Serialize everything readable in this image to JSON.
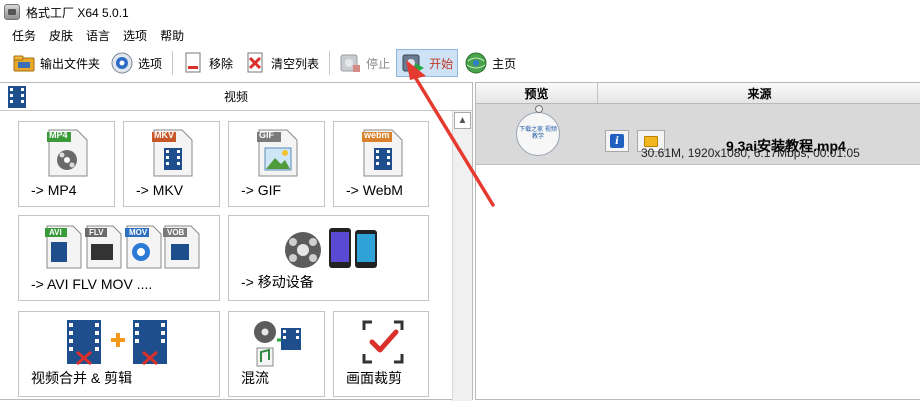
{
  "window": {
    "title": "格式工厂 X64 5.0.1"
  },
  "menu": {
    "items": [
      "任务",
      "皮肤",
      "语言",
      "选项",
      "帮助"
    ]
  },
  "toolbar": {
    "output_folder": "输出文件夹",
    "options": "选项",
    "remove": "移除",
    "clear_list": "清空列表",
    "stop": "停止",
    "start": "开始",
    "home": "主页"
  },
  "left": {
    "header": "视频",
    "tiles": {
      "mp4": {
        "label": "-> MP4",
        "badge": "MP4"
      },
      "mkv": {
        "label": "-> MKV",
        "badge": "MKV"
      },
      "gif": {
        "label": "-> GIF",
        "badge": "GIF"
      },
      "webm": {
        "label": "-> WebM",
        "badge": "webm"
      },
      "avi": {
        "label": "-> AVI FLV MOV ....",
        "badges": [
          "AVI",
          "FLV",
          "MOV",
          "VOB"
        ]
      },
      "mobile": {
        "label": "-> 移动设备"
      },
      "merge": {
        "label": "视频合并 & 剪辑"
      },
      "mux": {
        "label": "混流"
      },
      "crop": {
        "label": "画面裁剪"
      }
    }
  },
  "right": {
    "columns": {
      "preview": "预览",
      "source": "来源"
    },
    "task": {
      "filename": "9.3ai安装教程.mp4",
      "meta": "30.61M, 1920x1080, 6.17Mbps, 00:01:05",
      "thumb_text": "下载之家 视频教学"
    }
  },
  "colors": {
    "start_highlight": "#cde3f5",
    "arrow": "#e53a2f",
    "row_bg": "#d9d9d9"
  }
}
